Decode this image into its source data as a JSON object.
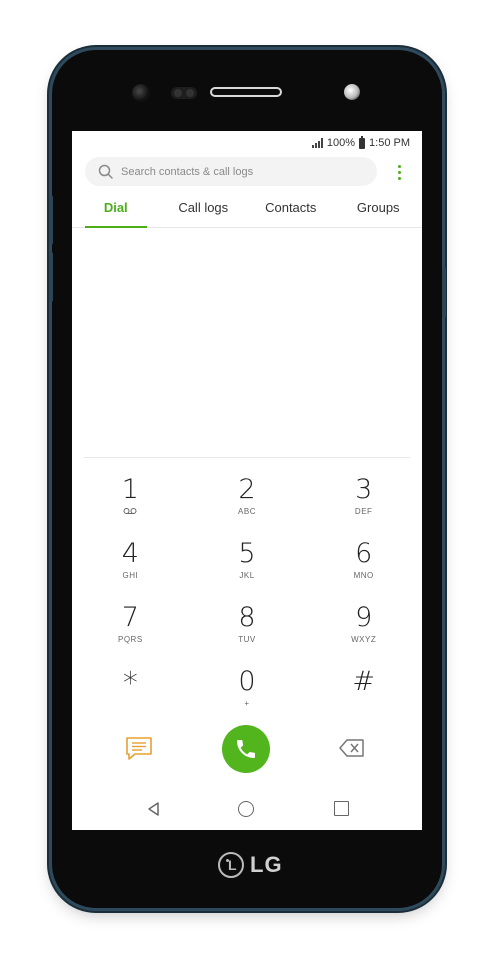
{
  "device": {
    "brand": "LG"
  },
  "status_bar": {
    "battery": "100%",
    "time": "1:50 PM"
  },
  "search": {
    "placeholder": "Search contacts & call logs"
  },
  "tabs": [
    {
      "label": "Dial",
      "active": true
    },
    {
      "label": "Call logs",
      "active": false
    },
    {
      "label": "Contacts",
      "active": false
    },
    {
      "label": "Groups",
      "active": false
    }
  ],
  "keypad": [
    [
      {
        "digit": "1",
        "letters": ""
      },
      {
        "digit": "2",
        "letters": "ABC"
      },
      {
        "digit": "3",
        "letters": "DEF"
      }
    ],
    [
      {
        "digit": "4",
        "letters": "GHI"
      },
      {
        "digit": "5",
        "letters": "JKL"
      },
      {
        "digit": "6",
        "letters": "MNO"
      }
    ],
    [
      {
        "digit": "7",
        "letters": "PQRS"
      },
      {
        "digit": "8",
        "letters": "TUV"
      },
      {
        "digit": "9",
        "letters": "WXYZ"
      }
    ],
    [
      {
        "digit": "*",
        "letters": ""
      },
      {
        "digit": "0",
        "letters": "+"
      },
      {
        "digit": "#",
        "letters": ""
      }
    ]
  ],
  "icons": {
    "key_1_sub": "voicemail-icon",
    "message": "message-icon",
    "call": "phone-icon",
    "backspace": "backspace-icon",
    "more": "more-vert-icon"
  },
  "colors": {
    "accent": "#4caf1a",
    "call_button": "#52b51e",
    "message_icon": "#e8a030"
  }
}
